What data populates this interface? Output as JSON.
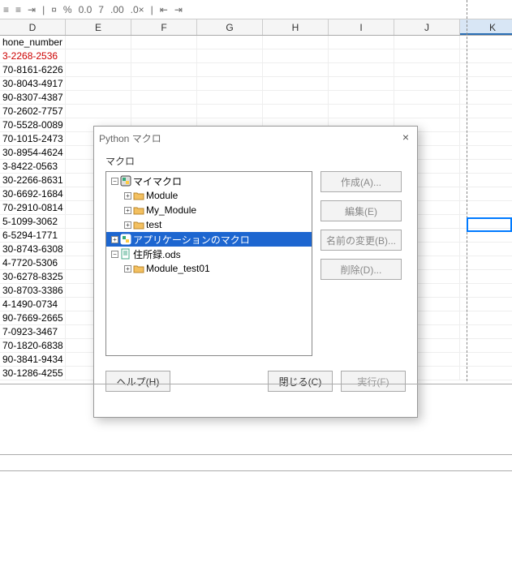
{
  "columns": [
    "D",
    "E",
    "F",
    "G",
    "H",
    "I",
    "J",
    "K"
  ],
  "selected_col": "K",
  "col_d": {
    "header": "hone_number",
    "values": [
      "3-2268-2536",
      "70-8161-6226",
      "30-8043-4917",
      "90-8307-4387",
      "70-2602-7757",
      "70-5528-0089",
      "70-1015-2473",
      "30-8954-4624",
      "3-8422-0563",
      "30-2266-8631",
      "30-6692-1684",
      "70-2910-0814",
      "5-1099-3062",
      "6-5294-1771",
      "30-8743-6308",
      "4-7720-5306",
      "30-6278-8325",
      "30-8703-3386",
      "4-1490-0734",
      "90-7669-2665",
      "7-0923-3467",
      "70-1820-6838",
      "90-3841-9434",
      "30-1286-4255"
    ]
  },
  "dialog": {
    "title": "Python マクロ",
    "section_label": "マクロ",
    "tree": [
      {
        "toggle": "-",
        "depth": 0,
        "icon": "pyroot",
        "label": "マイマクロ",
        "sel": false
      },
      {
        "toggle": "+",
        "depth": 1,
        "icon": "folder",
        "label": "Module",
        "sel": false
      },
      {
        "toggle": "+",
        "depth": 1,
        "icon": "folder",
        "label": "My_Module",
        "sel": false
      },
      {
        "toggle": "+",
        "depth": 1,
        "icon": "folder",
        "label": "test",
        "sel": false
      },
      {
        "toggle": "+",
        "depth": 0,
        "icon": "pyroot",
        "label": "アプリケーションのマクロ",
        "sel": true
      },
      {
        "toggle": "-",
        "depth": 0,
        "icon": "doc",
        "label": "住所録.ods",
        "sel": false
      },
      {
        "toggle": "+",
        "depth": 1,
        "icon": "folder",
        "label": "Module_test01",
        "sel": false
      }
    ],
    "buttons": {
      "create": "作成(A)...",
      "edit": "編集(E)",
      "rename": "名前の変更(B)...",
      "delete": "削除(D)..."
    },
    "footer": {
      "help": "ヘルプ(H)",
      "close": "閉じる(C)",
      "run": "実行(F)"
    }
  }
}
